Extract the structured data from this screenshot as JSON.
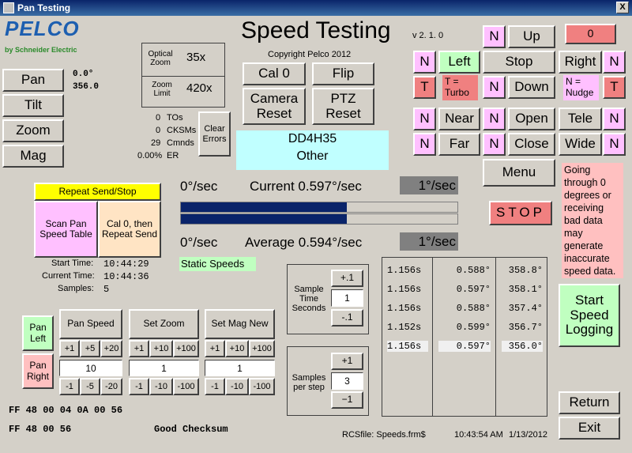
{
  "window": {
    "title": "Pan Testing",
    "close": "X"
  },
  "logo": {
    "brand": "PELCO",
    "sub": "by Schneider Electric"
  },
  "header": {
    "title": "Speed Testing",
    "version": "v 2. 1. 0",
    "copyright": "Copyright Pelco 2012"
  },
  "mode_buttons": {
    "pan": "Pan",
    "tilt": "Tilt",
    "zoom": "Zoom",
    "mag": "Mag"
  },
  "position": {
    "v1": "0.0°",
    "v2": "356.0"
  },
  "optical": {
    "optical_label": "Optical Zoom",
    "optical_value": "35x",
    "limit_label": "Zoom Limit",
    "limit_value": "420x"
  },
  "counters": {
    "tos_n": "0",
    "tos_l": "TOs",
    "ck_n": "0",
    "ck_l": "CKSMs",
    "cm_n": "29",
    "cm_l": "Cmnds",
    "er_n": "0.00%",
    "er_l": "ER",
    "clear": "Clear Errors"
  },
  "cmd": {
    "cal0": "Cal 0",
    "flip": "Flip",
    "camera_reset": "Camera Reset",
    "ptz_reset": "PTZ Reset"
  },
  "device": {
    "model": "DD4H35",
    "type": "Other"
  },
  "ptz": {
    "up": "Up",
    "left": "Left",
    "stop": "Stop",
    "right": "Right",
    "down": "Down",
    "near": "Near",
    "open": "Open",
    "tele": "Tele",
    "far": "Far",
    "close": "Close",
    "wide": "Wide",
    "menu": "Menu",
    "n": "N",
    "t": "T",
    "turbo": "T = Turbo",
    "nudge": "N = Nudge",
    "counter": "0"
  },
  "speed": {
    "cur_left": "0°/sec",
    "cur_label": "Current 0.597°/sec",
    "cur_right": "1°/sec",
    "avg_left": "0°/sec",
    "avg_label": "Average 0.594°/sec",
    "avg_right": "1°/sec",
    "bar1": 0.6,
    "bar2": 0.6,
    "static": "Static Speeds"
  },
  "stop": "STOP",
  "warning": "Going through 0 degrees or receiving bad data may generate inaccurate speed data.",
  "repeat": {
    "header": "Repeat Send/Stop",
    "scan": "Scan Pan Speed Table",
    "cal": "Cal 0, then Repeat Send"
  },
  "times": {
    "start_l": "Start Time:",
    "start_v": "10:44:29",
    "cur_l": "Current Time:",
    "cur_v": "10:44:36",
    "samp_l": "Samples:",
    "samp_v": "5"
  },
  "sample_time": {
    "label": "Sample Time Seconds",
    "plus": "+.1",
    "value": "1",
    "minus": "-.1"
  },
  "samples_step": {
    "label": "Samples per step",
    "plus": "+1",
    "value": "3",
    "minus": "−1"
  },
  "table": {
    "rows": [
      [
        "1.156s",
        "0.588°",
        "358.8°"
      ],
      [
        "1.156s",
        "0.597°",
        "358.1°"
      ],
      [
        "1.156s",
        "0.588°",
        "357.4°"
      ],
      [
        "1.152s",
        "0.599°",
        "356.7°"
      ],
      [
        "1.156s",
        "0.597°",
        "356.0°"
      ]
    ]
  },
  "logging": "Start Speed Logging",
  "pan_side": {
    "left": "Pan Left",
    "right": "Pan Right"
  },
  "pan_speed": {
    "title": "Pan Speed",
    "p1": "+1",
    "p5": "+5",
    "p20": "+20",
    "value": "10",
    "m1": "-1",
    "m5": "-5",
    "m20": "-20"
  },
  "set_zoom": {
    "title": "Set Zoom",
    "p1": "+1",
    "p10": "+10",
    "p100": "+100",
    "value": "1",
    "m1": "-1",
    "m10": "-10",
    "m100": "-100"
  },
  "set_mag": {
    "title": "Set Mag New",
    "p1": "+1",
    "p10": "+10",
    "p100": "+100",
    "value": "1",
    "m1": "-1",
    "m10": "-10",
    "m100": "-100"
  },
  "hex": {
    "line1": "FF 48 00 04 0A 00 56",
    "line2": "FF 48 00 56",
    "checksum": "Good Checksum"
  },
  "footer": {
    "rcs": "RCSfile: Speeds.frm$",
    "time": "10:43:54 AM",
    "date": "1/13/2012"
  },
  "nav": {
    "return": "Return",
    "exit": "Exit"
  }
}
